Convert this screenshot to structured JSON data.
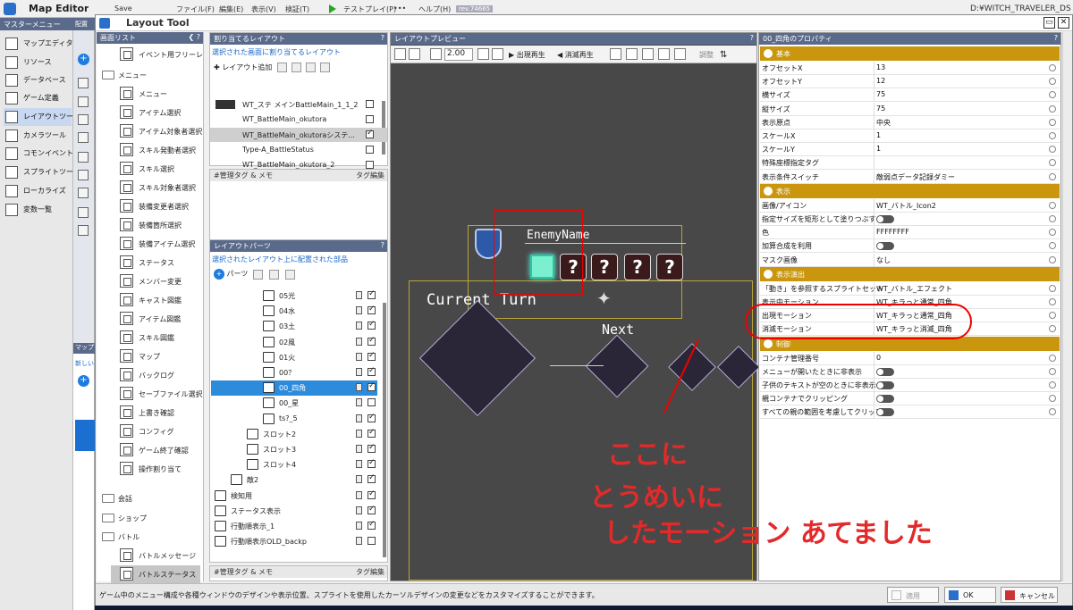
{
  "app": {
    "title": "Map Editor",
    "menu": [
      "Save",
      "ファイル(F)",
      "編集(E)",
      "表示(V)",
      "検証(T)",
      "テストプレイ(P)",
      "•••",
      "ヘルプ(H)"
    ],
    "rev": "rev.74665",
    "path": "D:¥WITCH_TRAVELER_DS"
  },
  "master": {
    "header": "マスターメニュー",
    "items": [
      "マップエディター",
      "リソース",
      "データベース",
      "ゲーム定義",
      "レイアウトツール",
      "カメラツール",
      "コモンイベント",
      "スプライトツール",
      "ローカライズ",
      "変数一覧"
    ]
  },
  "strip": {
    "header": "配置",
    "header2": "マップ",
    "note": "新しいレ"
  },
  "layout_tool": {
    "title": "Layout Tool"
  },
  "screen_list": {
    "header": "画面リスト",
    "first": "イベント用フリーレ",
    "categories": [
      "メニュー",
      "会話",
      "ショップ",
      "バトル"
    ],
    "menu_items": [
      "メニュー",
      "アイテム選択",
      "アイテム対象者選択",
      "スキル発動者選択",
      "スキル選択",
      "スキル対象者選択",
      "装備変更者選択",
      "装備箇所選択",
      "装備アイテム選択",
      "ステータス",
      "メンバー変更",
      "キャスト図鑑",
      "アイテム図鑑",
      "スキル図鑑",
      "マップ",
      "バックログ",
      "セーブファイル選択",
      "上書き確認",
      "コンフィグ",
      "ゲーム終了確認",
      "操作割り当て"
    ],
    "battle_items": [
      "バトルメッセージ",
      "バトルステータス"
    ]
  },
  "assign": {
    "header": "割り当てるレイアウト",
    "note": "選択された画面に割り当てるレイアウト",
    "add": "レイアウト追加",
    "rows": [
      {
        "name": "WT_ステ メインBattleMain_1_1_2",
        "checked": false
      },
      {
        "name": "WT_BattleMain_okutora",
        "checked": false
      },
      {
        "name": "WT_BattleMain_okutoraシステ...",
        "checked": true
      },
      {
        "name": "Type-A_BattleStatus",
        "checked": false
      },
      {
        "name": "WT_BattleMain_okutora_2",
        "checked": false
      }
    ]
  },
  "kanri": {
    "header": "#管理タグ & メモ",
    "tag": "タグ編集"
  },
  "parts": {
    "header": "レイアウトパーツ",
    "note": "選択されたレイアウト上に配置された部品",
    "add": "パーツ",
    "rows": [
      {
        "name": "05光",
        "indent": 3,
        "checked": true
      },
      {
        "name": "04水",
        "indent": 3,
        "checked": true
      },
      {
        "name": "03土",
        "indent": 3,
        "checked": true
      },
      {
        "name": "02風",
        "indent": 3,
        "checked": true
      },
      {
        "name": "01火",
        "indent": 3,
        "checked": true
      },
      {
        "name": "00？",
        "indent": 3,
        "checked": true
      },
      {
        "name": "00_四角",
        "indent": 3,
        "checked": true
      },
      {
        "name": "00_星",
        "indent": 3,
        "checked": false
      },
      {
        "name": "ts?_5",
        "indent": 3,
        "checked": true
      },
      {
        "name": "スロット2",
        "indent": 2,
        "checked": true
      },
      {
        "name": "スロット3",
        "indent": 2,
        "checked": true
      },
      {
        "name": "スロット4",
        "indent": 2,
        "checked": true
      },
      {
        "name": "敵2",
        "indent": 1,
        "checked": true
      },
      {
        "name": "検知用",
        "indent": 0,
        "checked": true
      },
      {
        "name": "ステータス表示",
        "indent": 0,
        "checked": true
      },
      {
        "name": "行動順表示_1",
        "indent": 0,
        "checked": true
      },
      {
        "name": "行動順表示OLD_backp",
        "indent": 0,
        "checked": false
      }
    ]
  },
  "preview": {
    "header": "レイアウトプレビュー",
    "zoom": "2.00",
    "appear": "出現再生",
    "vanish": "消滅再生",
    "adjust": "調整",
    "enemy_name": "EnemyName",
    "current_turn": "Current Turn",
    "next": "Next",
    "qmark": "?"
  },
  "annotation": {
    "line1": "ここに",
    "line2": "とうめいに",
    "line3": "したモーション あてました"
  },
  "props": {
    "header": "00_四角のプロパティ",
    "sections": [
      {
        "title": "基本",
        "rows": [
          {
            "k": "オフセットX",
            "v": "13"
          },
          {
            "k": "オフセットY",
            "v": "12"
          },
          {
            "k": "横サイズ",
            "v": "75"
          },
          {
            "k": "縦サイズ",
            "v": "75"
          },
          {
            "k": "表示原点",
            "v": "中央"
          },
          {
            "k": "スケールX",
            "v": "1"
          },
          {
            "k": "スケールY",
            "v": "1"
          },
          {
            "k": "特殊座標指定タグ",
            "v": ""
          },
          {
            "k": "表示条件スイッチ",
            "v": "敵弱点データ記録ダミー"
          }
        ]
      },
      {
        "title": "表示",
        "rows": [
          {
            "k": "画像/アイコン",
            "v": "WT_バトル_Icon2"
          },
          {
            "k": "指定サイズを矩形として塗りつぶす",
            "v": ""
          },
          {
            "k": "色",
            "v": "FFFFFFFF"
          },
          {
            "k": "加算合成を利用",
            "v": ""
          },
          {
            "k": "マスク画像",
            "v": "なし"
          }
        ]
      },
      {
        "title": "表示演出",
        "rows": [
          {
            "k": "「動き」を参照するスプライトセット",
            "v": "WT_バトル_エフェクト"
          },
          {
            "k": "表示中モーション",
            "v": "WT_キラっと通常_四角"
          },
          {
            "k": "出現モーション",
            "v": "WT_キラっと通常_四角"
          },
          {
            "k": "消滅モーション",
            "v": "WT_キラっと消滅_四角"
          }
        ]
      },
      {
        "title": "制御",
        "rows": [
          {
            "k": "コンテナ管理番号",
            "v": "0"
          },
          {
            "k": "メニューが開いたときに非表示",
            "v": ""
          },
          {
            "k": "子供のテキストが空のときに非表示",
            "v": ""
          },
          {
            "k": "親コンテナでクリッピング",
            "v": ""
          },
          {
            "k": "すべての親の範囲を考慮してクリップ",
            "v": ""
          }
        ]
      }
    ]
  },
  "status": {
    "text": "ゲーム中のメニュー構成や各種ウィンドウのデザインや表示位置、スプライトを使用したカーソルデザインの変更などをカスタマイズすることができます。",
    "apply": "適用",
    "ok": "OK",
    "cancel": "キャンセル"
  },
  "colors": {
    "accent": "#c9960e",
    "select": "#2d8bdc",
    "annot": "#e32a2a"
  }
}
